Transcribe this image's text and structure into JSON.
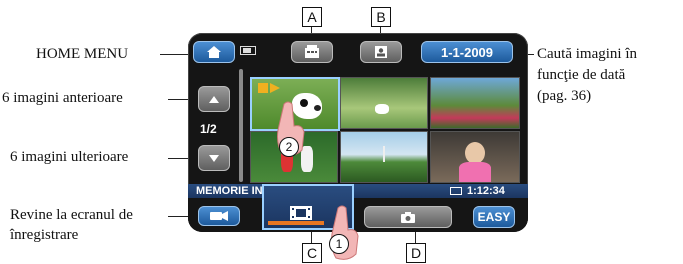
{
  "callouts": {
    "home_menu": "HOME MENU",
    "previous": "6 imagini anterioare",
    "next": "6 imagini ulterioare",
    "return_line1": "Revine la ecranul de",
    "return_line2": "înregistrare",
    "date_line1": "Caută imagini în",
    "date_line2": "funcţie de dată",
    "date_line3": "(pag. 36)"
  },
  "labels": {
    "a": "A",
    "b": "B",
    "c": "C",
    "d": "D"
  },
  "steps": {
    "one": "1",
    "two": "2"
  },
  "screen": {
    "date_button": "1-1-2009",
    "page_indicator": "1/2",
    "storage_label": "MEMORIE INTERNĂ",
    "duration": "1:12:34",
    "easy_button": "EASY"
  },
  "colors": {
    "accent_blue": "#1d5a9c",
    "orange_bar": "#e87722",
    "screen_bg": "#151515",
    "highlight": "#9ad0ff"
  },
  "icons": {
    "home": "home-icon",
    "battery": "battery-icon",
    "movie_list": "movie-list-icon",
    "photo_list": "photo-list-icon",
    "camera_return": "camcorder-icon",
    "film": "film-icon",
    "camera": "camera-icon"
  }
}
